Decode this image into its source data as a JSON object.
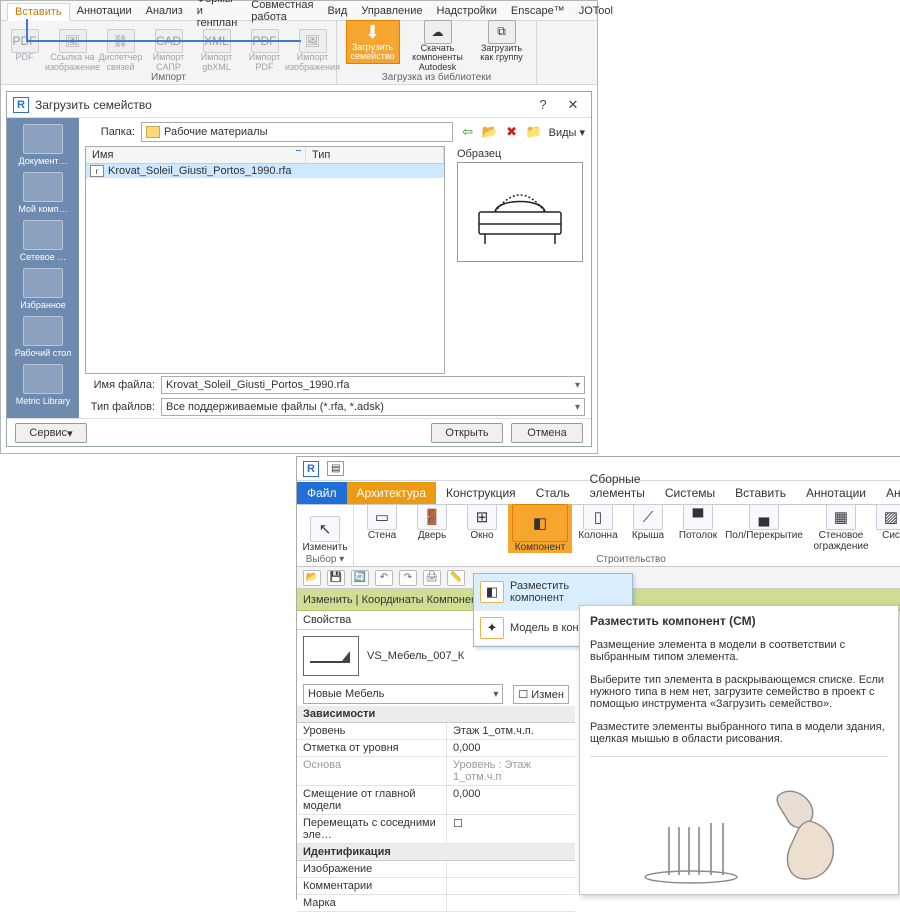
{
  "tabs_top": [
    "Вставить",
    "Аннотации",
    "Анализ",
    "Формы и генплан",
    "Совместная работа",
    "Вид",
    "Управление",
    "Надстройки",
    "Enscape™",
    "JOTool"
  ],
  "active_tab_top": "Вставить",
  "ribbon1_tools": [
    "PDF",
    "Ссылка на изображение",
    "Диспетчер связей",
    "Импорт САПР",
    "Импорт gbXML",
    "Импорт PDF",
    "Импорт изображения"
  ],
  "load_family": "Загрузить семейство",
  "ribbon1_more": [
    "Скачать компоненты Autodesk",
    "Загрузить как группу"
  ],
  "group_import": "Импорт",
  "group_load": "Загрузка из библиотеки",
  "dialog": {
    "title": "Загрузить семейство",
    "folder_lbl": "Папка:",
    "folder": "Рабочие материалы",
    "views_lbl": "Виды",
    "preview_lbl": "Образец",
    "col_name": "Имя",
    "col_type": "Тип",
    "file": "Krovat_Soleil_Giusti_Portos_1990.rfa",
    "filename_lbl": "Имя файла:",
    "filetype_lbl": "Тип файлов:",
    "filetype": "Все поддерживаемые файлы  (*.rfa, *.adsk)",
    "service": "Сервис",
    "open": "Открыть",
    "cancel": "Отмена"
  },
  "shortcuts": [
    "Документ…",
    "Мой комп…",
    "Сетевое …",
    "Избранное",
    "Рабочий стол",
    "Metric Library"
  ],
  "tabs_low": [
    "Файл",
    "Архитектура",
    "Конструкция",
    "Сталь",
    "Сборные элементы",
    "Системы",
    "Вставить",
    "Аннотации",
    "Анализ"
  ],
  "ribbon2": {
    "select": "Выбор",
    "modify": "Изменить",
    "wall": "Стена",
    "door": "Дверь",
    "window": "Окно",
    "component": "Компонент",
    "column": "Колонна",
    "roof": "Крыша",
    "ceiling": "Потолок",
    "floor": "Пол/Перекрытие",
    "curtain": "Стеновое ограждение",
    "sys": "Сис",
    "build": "Строительство"
  },
  "modbar": "Изменить | Координаты Компонент",
  "dropdown": {
    "place": "Разместить компонент",
    "in_context": "Модель в конте"
  },
  "tooltip": {
    "title": "Разместить компонент (СМ)",
    "p1": "Размещение элемента в модели в соответствии с выбранным типом элемента.",
    "p2": "Выберите тип элемента в раскрывающемся списке. Если нужного типа в нем нет, загрузите семейство в проект с помощью инструмента «Загрузить семейство».",
    "p3": "Разместите элементы выбранного типа в модели здания, щелкая мышью в области рисования."
  },
  "props": {
    "title": "Свойства",
    "type_name": "VS_Мебель_007_К",
    "type_sel": "Новые Мебель",
    "edit_type": "Измен",
    "cat_dep": "Зависимости",
    "level": "Уровень",
    "level_v": "Этаж 1_отм.ч.п.",
    "elev": "Отметка от уровня",
    "elev_v": "0,000",
    "host": "Основа",
    "host_v": "Уровень : Этаж 1_отм.ч.п",
    "offset": "Смещение от главной модели",
    "offset_v": "0,000",
    "moves": "Перемещать с соседними эле…",
    "cat_id": "Идентификация",
    "image": "Изображение",
    "comments": "Комментарии",
    "mark": "Марка"
  }
}
